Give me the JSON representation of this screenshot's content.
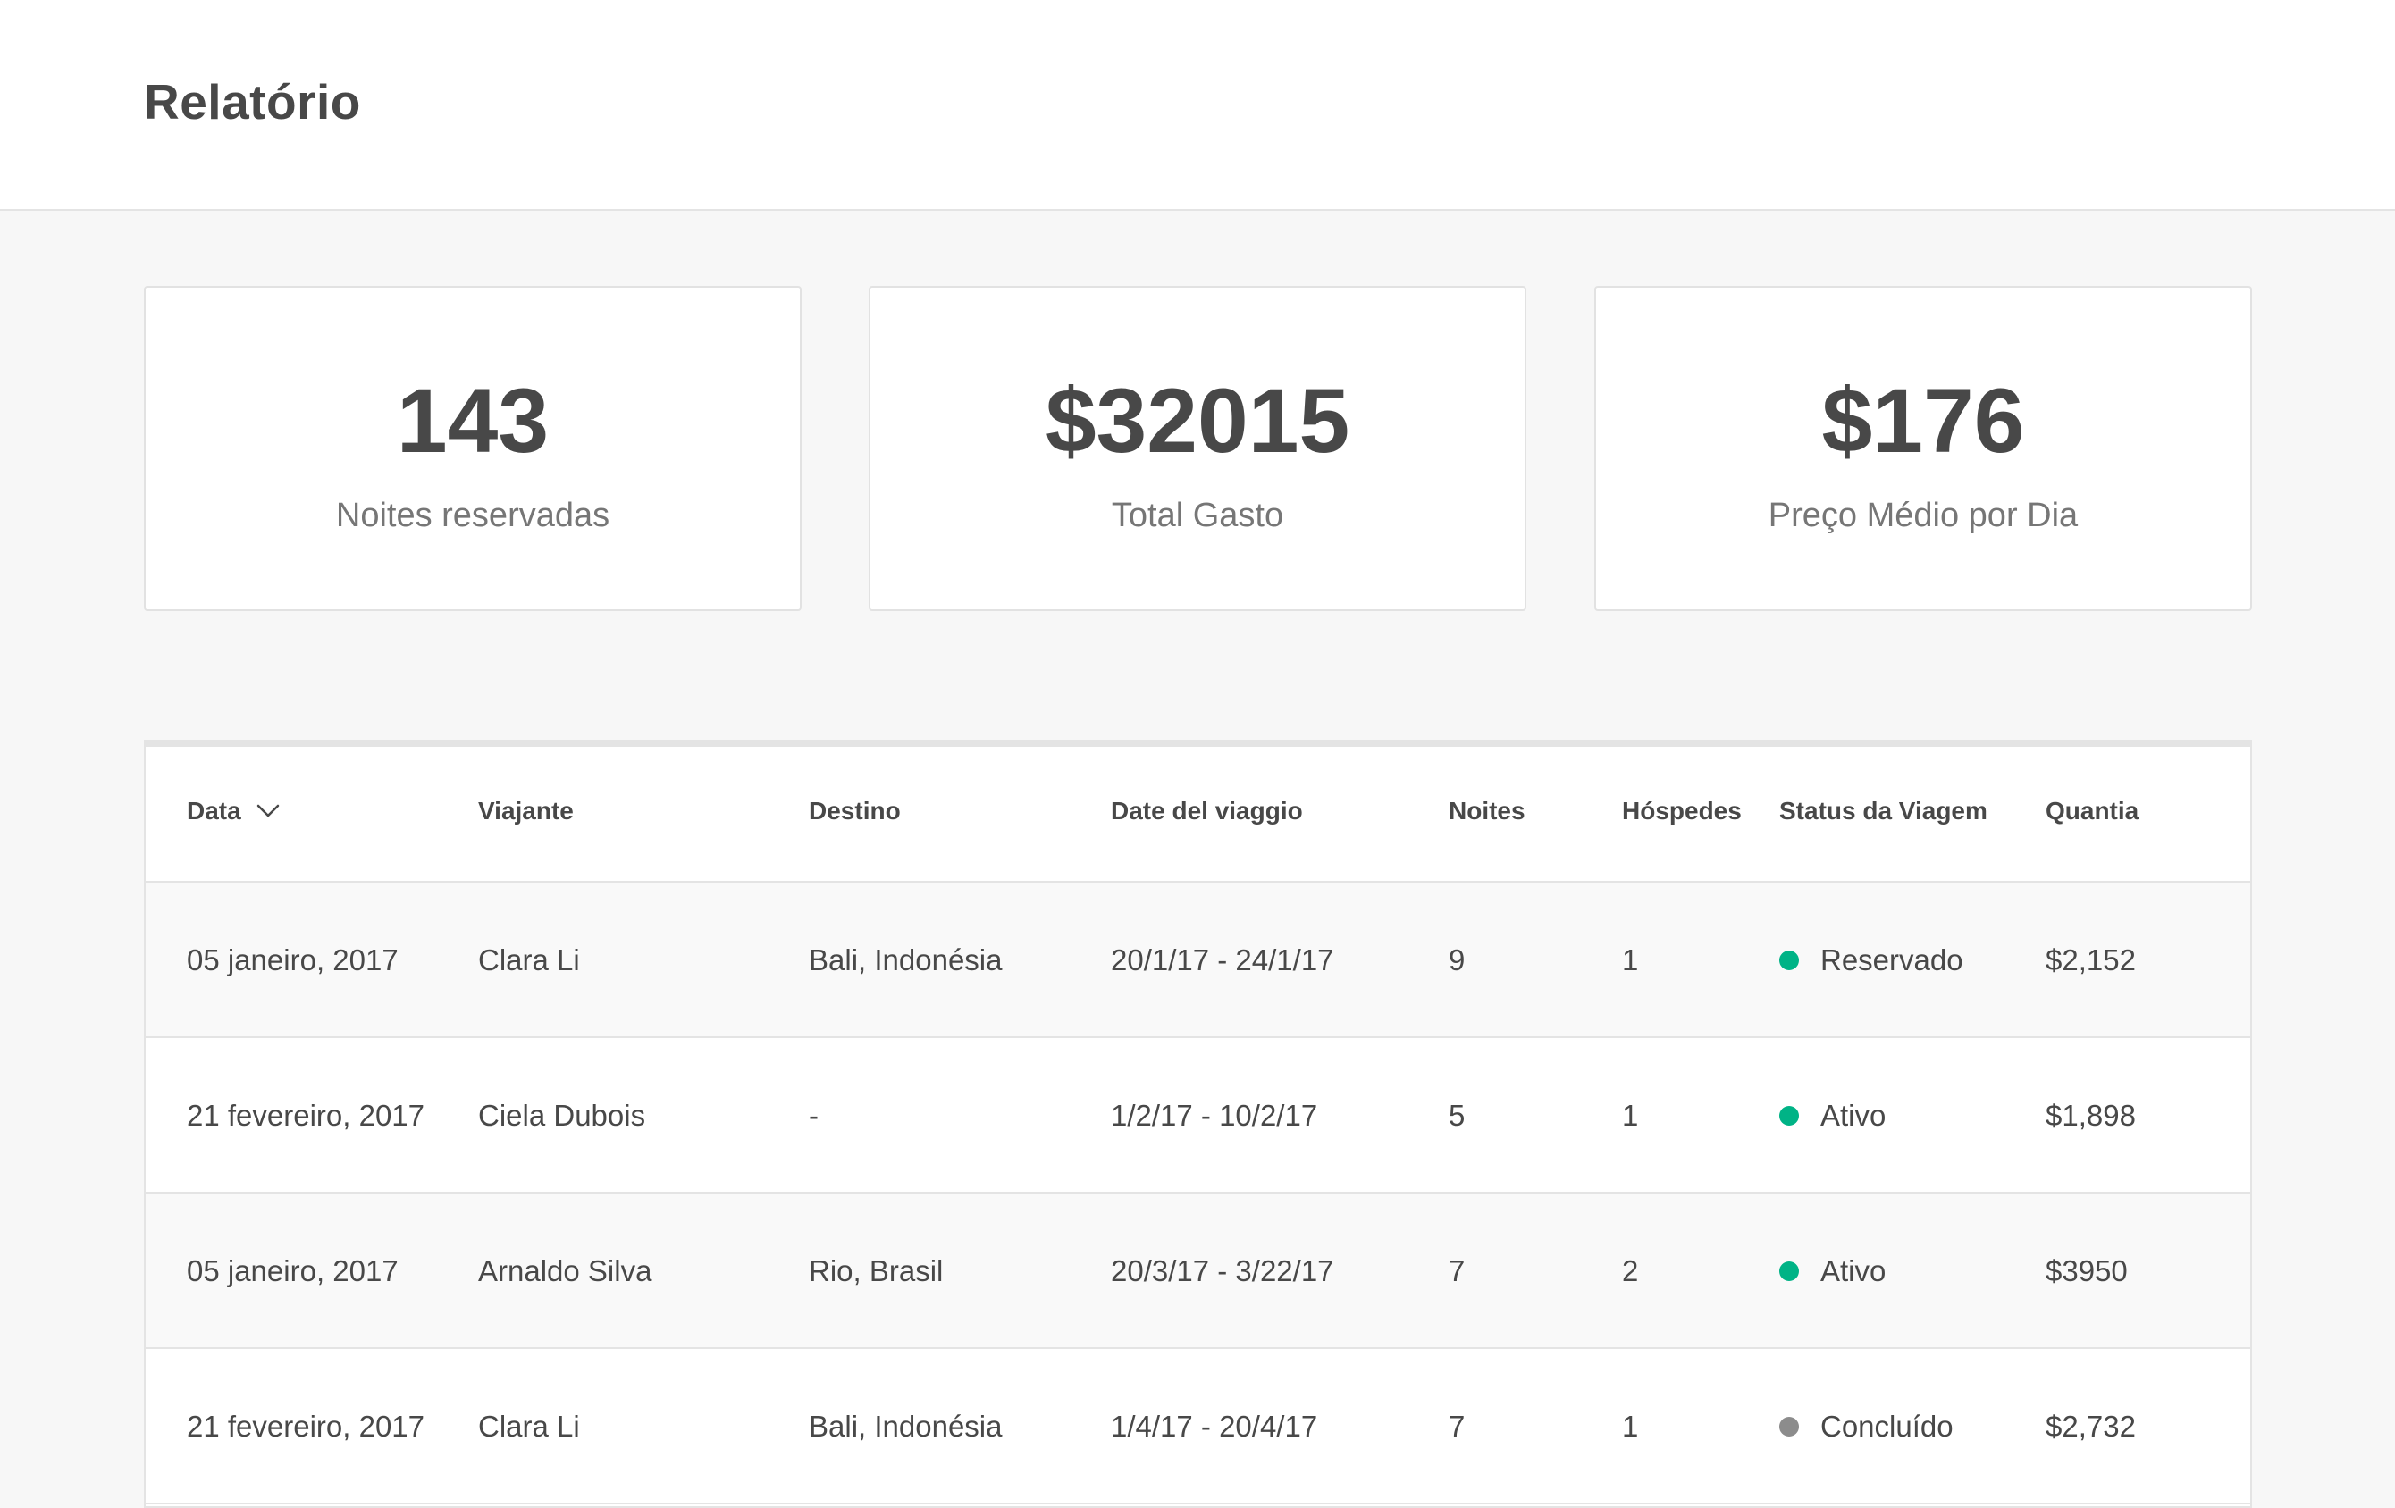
{
  "header": {
    "title": "Relatório"
  },
  "stats": [
    {
      "value": "143",
      "label": "Noites reservadas"
    },
    {
      "value": "$32015",
      "label": "Total Gasto"
    },
    {
      "value": "$176",
      "label": "Preço Médio por Dia"
    }
  ],
  "table": {
    "columns": {
      "date": "Data",
      "traveler": "Viajante",
      "destination": "Destino",
      "trip_dates": "Date del viaggio",
      "nights": "Noites",
      "guests": "Hóspedes",
      "status": "Status da Viagem",
      "amount": "Quantia"
    },
    "sort_icon": "chevron-down-icon",
    "rows": [
      {
        "date": "05 janeiro, 2017",
        "traveler": "Clara Li",
        "destination": "Bali, Indonésia",
        "trip_dates": "20/1/17 - 24/1/17",
        "nights": "9",
        "guests": "1",
        "status": "Reservado",
        "status_color": "#00b386",
        "amount": "$2,152"
      },
      {
        "date": "21 fevereiro, 2017",
        "traveler": "Ciela Dubois",
        "destination": "-",
        "trip_dates": "1/2/17 - 10/2/17",
        "nights": "5",
        "guests": "1",
        "status": "Ativo",
        "status_color": "#00b386",
        "amount": "$1,898"
      },
      {
        "date": "05 janeiro, 2017",
        "traveler": "Arnaldo Silva",
        "destination": "Rio, Brasil",
        "trip_dates": "20/3/17 - 3/22/17",
        "nights": "7",
        "guests": "2",
        "status": "Ativo",
        "status_color": "#00b386",
        "amount": "$3950"
      },
      {
        "date": "21 fevereiro, 2017",
        "traveler": "Clara Li",
        "destination": "Bali, Indonésia",
        "trip_dates": "1/4/17 - 20/4/17",
        "nights": "7",
        "guests": "1",
        "status": "Concluído",
        "status_color": "#8c8c8c",
        "amount": "$2,732"
      }
    ]
  }
}
